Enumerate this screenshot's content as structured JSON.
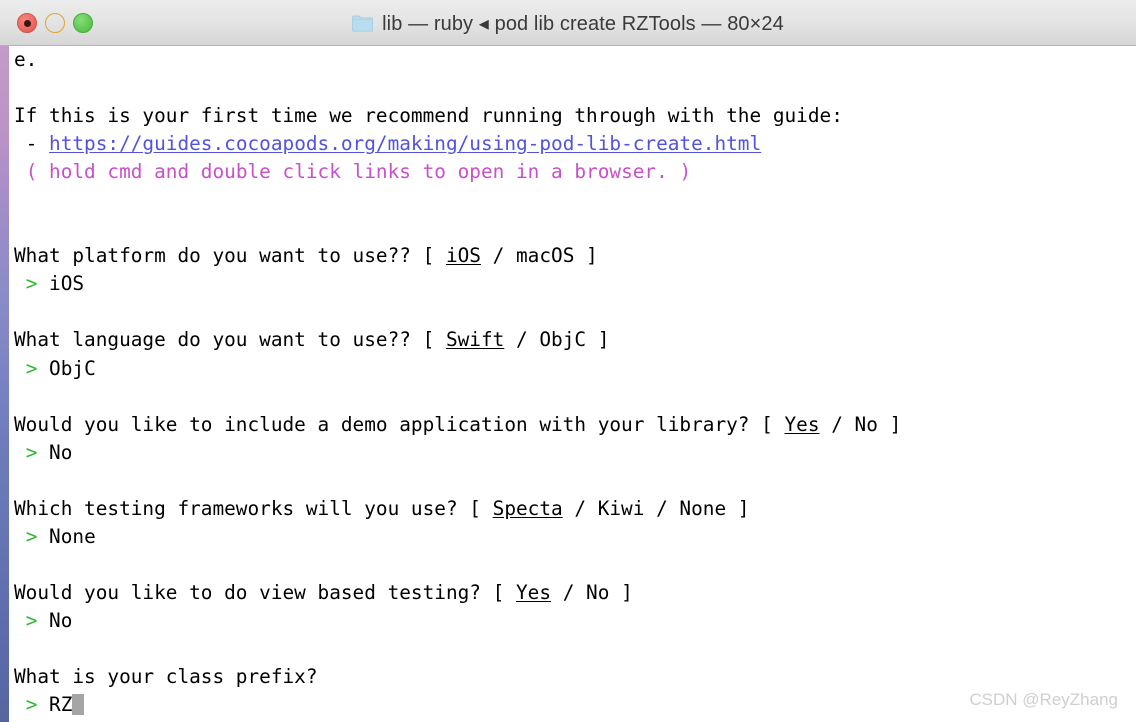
{
  "window": {
    "title": "lib — ruby ◂ pod lib create RZTools — 80×24",
    "folder_icon": "folder-icon",
    "traffic_lights": {
      "close_label": "close",
      "minimize_label": "minimize",
      "zoom_label": "zoom"
    }
  },
  "colors": {
    "titlebar_top": "#ececec",
    "titlebar_bottom": "#d6d6d6",
    "terminal_bg": "#ffffff",
    "text": "#000000",
    "link": "#5252e0",
    "magenta": "#c850c8",
    "green_prompt": "#2eb82e",
    "cursor": "#a5a5a5",
    "close_button": "#ec6a60",
    "minimize_button": "#f6c84f",
    "zoom_button": "#63ca57",
    "folder": "#b9dcef",
    "watermark": "#cfcfcf"
  },
  "terminal": {
    "lines": [
      {
        "id": "line-e",
        "segments": [
          {
            "text": "e.",
            "style": "default"
          }
        ]
      },
      {
        "id": "line-blank-1",
        "segments": [
          {
            "text": "",
            "style": "default"
          }
        ]
      },
      {
        "id": "line-guide-intro",
        "segments": [
          {
            "text": "If this is your first time we recommend running through with the guide:",
            "style": "default"
          }
        ]
      },
      {
        "id": "line-guide-url",
        "segments": [
          {
            "text": " - ",
            "style": "default"
          },
          {
            "text": "https://guides.cocoapods.org/making/using-pod-lib-create.html",
            "style": "link"
          }
        ]
      },
      {
        "id": "line-guide-hint",
        "segments": [
          {
            "text": " ",
            "style": "default"
          },
          {
            "text": "( hold cmd and double click links to open in a browser. )",
            "style": "magenta"
          }
        ]
      },
      {
        "id": "line-blank-2",
        "segments": [
          {
            "text": "",
            "style": "default"
          }
        ]
      },
      {
        "id": "line-blank-3",
        "segments": [
          {
            "text": "",
            "style": "default"
          }
        ]
      },
      {
        "id": "line-q-platform",
        "segments": [
          {
            "text": "What platform do you want to use?? [ ",
            "style": "default"
          },
          {
            "text": "iOS",
            "style": "underline"
          },
          {
            "text": " / macOS ]",
            "style": "default"
          }
        ]
      },
      {
        "id": "line-a-platform",
        "segments": [
          {
            "text": " ",
            "style": "default"
          },
          {
            "text": ">",
            "style": "green"
          },
          {
            "text": " iOS",
            "style": "default"
          }
        ]
      },
      {
        "id": "line-blank-4",
        "segments": [
          {
            "text": "",
            "style": "default"
          }
        ]
      },
      {
        "id": "line-q-language",
        "segments": [
          {
            "text": "What language do you want to use?? [ ",
            "style": "default"
          },
          {
            "text": "Swift",
            "style": "underline"
          },
          {
            "text": " / ObjC ]",
            "style": "default"
          }
        ]
      },
      {
        "id": "line-a-language",
        "segments": [
          {
            "text": " ",
            "style": "default"
          },
          {
            "text": ">",
            "style": "green"
          },
          {
            "text": " ObjC",
            "style": "default"
          }
        ]
      },
      {
        "id": "line-blank-5",
        "segments": [
          {
            "text": "",
            "style": "default"
          }
        ]
      },
      {
        "id": "line-q-demo",
        "segments": [
          {
            "text": "Would you like to include a demo application with your library? [ ",
            "style": "default"
          },
          {
            "text": "Yes",
            "style": "underline"
          },
          {
            "text": " / No ]",
            "style": "default"
          }
        ]
      },
      {
        "id": "line-a-demo",
        "segments": [
          {
            "text": " ",
            "style": "default"
          },
          {
            "text": ">",
            "style": "green"
          },
          {
            "text": " No",
            "style": "default"
          }
        ]
      },
      {
        "id": "line-blank-6",
        "segments": [
          {
            "text": "",
            "style": "default"
          }
        ]
      },
      {
        "id": "line-q-testing",
        "segments": [
          {
            "text": "Which testing frameworks will you use? [ ",
            "style": "default"
          },
          {
            "text": "Specta",
            "style": "underline"
          },
          {
            "text": " / Kiwi / None ]",
            "style": "default"
          }
        ]
      },
      {
        "id": "line-a-testing",
        "segments": [
          {
            "text": " ",
            "style": "default"
          },
          {
            "text": ">",
            "style": "green"
          },
          {
            "text": " None",
            "style": "default"
          }
        ]
      },
      {
        "id": "line-blank-7",
        "segments": [
          {
            "text": "",
            "style": "default"
          }
        ]
      },
      {
        "id": "line-q-viewtest",
        "segments": [
          {
            "text": "Would you like to do view based testing? [ ",
            "style": "default"
          },
          {
            "text": "Yes",
            "style": "underline"
          },
          {
            "text": " / No ]",
            "style": "default"
          }
        ]
      },
      {
        "id": "line-a-viewtest",
        "segments": [
          {
            "text": " ",
            "style": "default"
          },
          {
            "text": ">",
            "style": "green"
          },
          {
            "text": " No",
            "style": "default"
          }
        ]
      },
      {
        "id": "line-blank-8",
        "segments": [
          {
            "text": "",
            "style": "default"
          }
        ]
      },
      {
        "id": "line-q-prefix",
        "segments": [
          {
            "text": "What is your class prefix?",
            "style": "default"
          }
        ]
      },
      {
        "id": "line-a-prefix",
        "segments": [
          {
            "text": " ",
            "style": "default"
          },
          {
            "text": ">",
            "style": "green"
          },
          {
            "text": " RZ",
            "style": "default"
          },
          {
            "text": "",
            "style": "cursor"
          }
        ]
      }
    ]
  },
  "watermark": {
    "text": "CSDN @ReyZhang"
  }
}
